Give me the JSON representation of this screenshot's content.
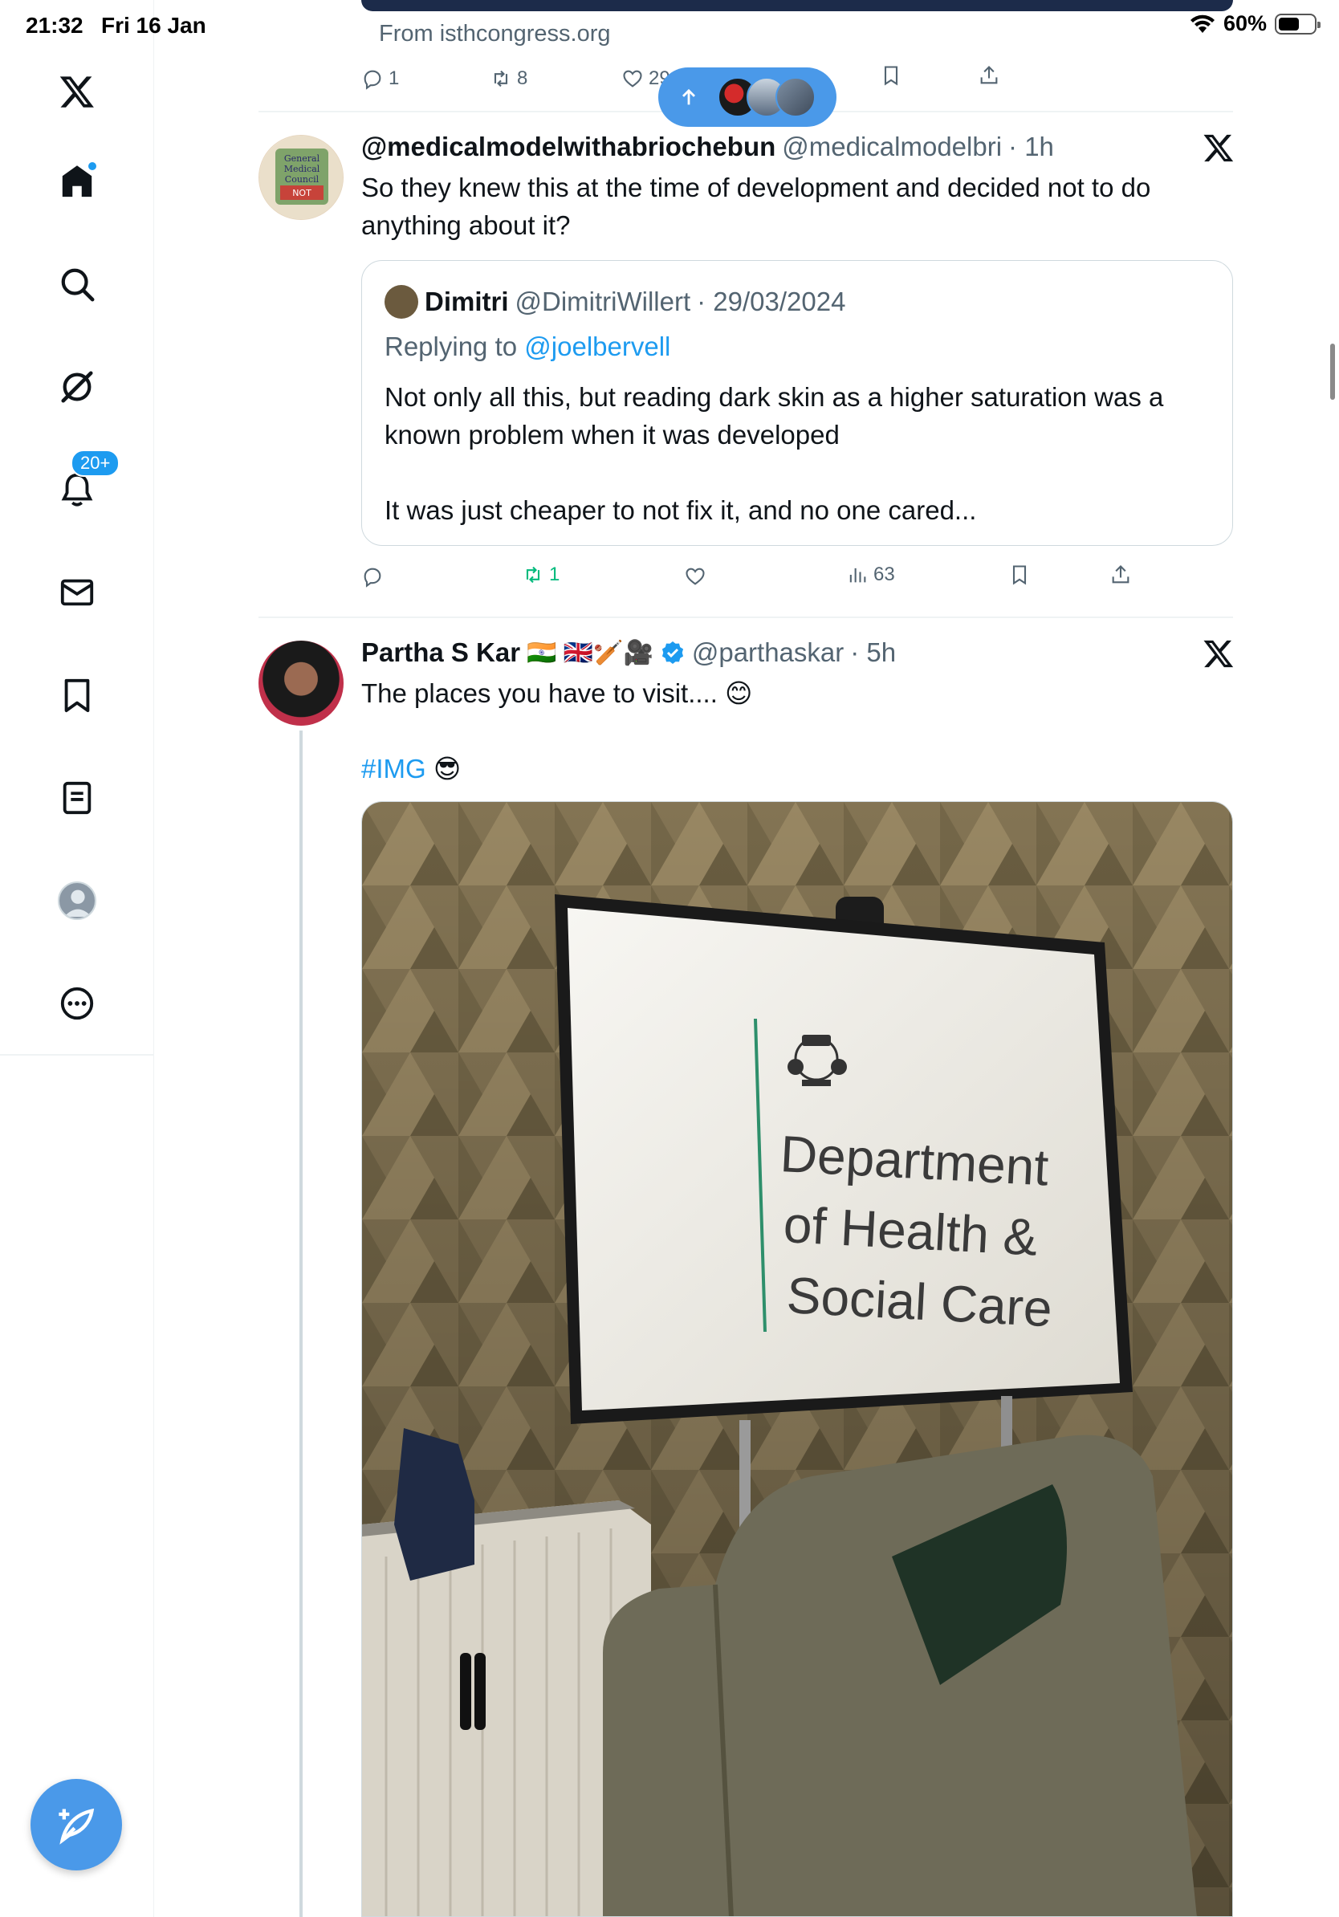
{
  "status_bar": {
    "time": "21:32",
    "date": "Fri 16 Jan",
    "battery": "60%"
  },
  "sidebar": {
    "items": [
      {
        "icon": "x-logo-icon"
      },
      {
        "icon": "home-icon",
        "active": true
      },
      {
        "icon": "search-icon"
      },
      {
        "icon": "grok-icon"
      },
      {
        "icon": "bell-icon",
        "badge": "20+"
      },
      {
        "icon": "mail-icon"
      },
      {
        "icon": "bookmark-icon"
      },
      {
        "icon": "lists-icon"
      },
      {
        "icon": "profile-icon"
      },
      {
        "icon": "more-icon"
      }
    ],
    "compose_icon": "compose-icon"
  },
  "prev_post": {
    "from": "From isthcongress.org",
    "replies": "1",
    "reposts": "8",
    "likes": "29"
  },
  "new_posts_pill": {
    "icon": "arrow-up-icon"
  },
  "post1": {
    "name": "@medicalmodelwithabriochebun",
    "handle": "@medicalmodelbri",
    "time": "· 1h",
    "text_line1": "So they knew this at the time of development and decided not to do",
    "text_line2": "anything about it?",
    "avatar_text": [
      "General",
      "Medical",
      "Council",
      "NOT"
    ],
    "quote": {
      "name": "Dimitri",
      "handle": "@DimitriWillert",
      "date": "· 29/03/2024",
      "replying_label": "Replying to",
      "replying_to": "@joelbervell",
      "line1": "Not only all this, but reading dark skin as a higher saturation was a",
      "line2": "known problem when it was developed",
      "line3": "It was just cheaper to not fix it, and no one cared..."
    },
    "reposts": "1",
    "views": "63"
  },
  "post2": {
    "name": "Partha S Kar",
    "emoji": "🇮🇳 🇬🇧🏏🎥",
    "handle": "@parthaskar",
    "time": "· 5h",
    "text": "The places you have to visit.... 😊",
    "hashtag": "#IMG",
    "hashtag_emoji": "😎",
    "photo": {
      "line1": "Department",
      "line2": "of Health &",
      "line3": "Social Care"
    }
  },
  "colors": {
    "accent": "#1d9bf0",
    "repost_green": "#00ba7c",
    "text_secondary": "#536471",
    "border": "#cfd9de"
  }
}
